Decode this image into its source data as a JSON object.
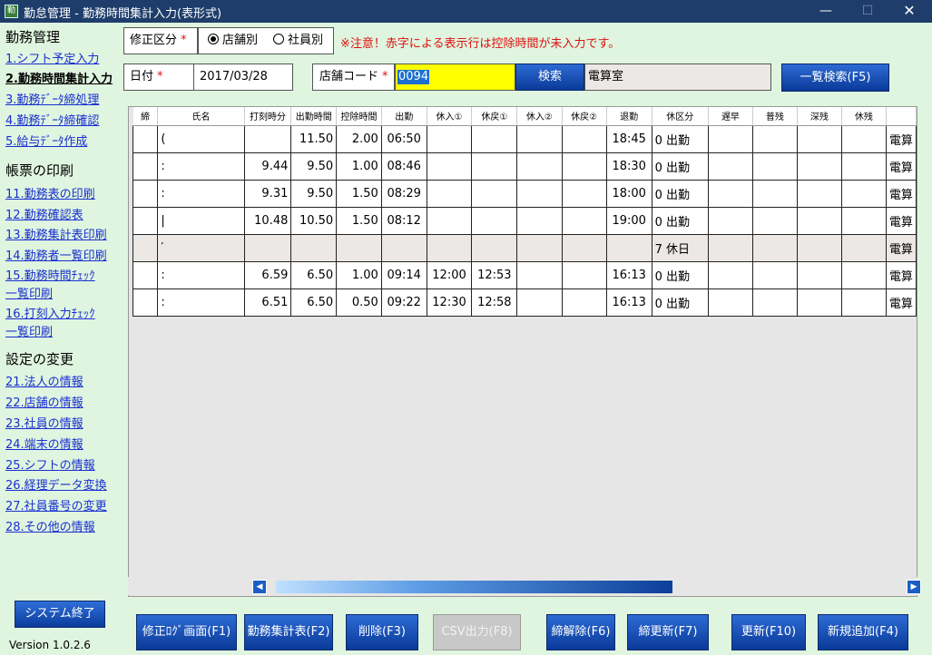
{
  "window": {
    "title": "勤怠管理 - 勤務時間集計入力(表形式)",
    "icon": "app-icon",
    "minimize": "—",
    "maximize": "☐",
    "close": "✕"
  },
  "sidebar": {
    "section1": "勤務管理",
    "links1": [
      "1.シフト予定入力",
      "2.勤務時間集計入力",
      "3.勤務ﾃﾞｰﾀ締処理",
      "4.勤務ﾃﾞｰﾀ締確認",
      "5.給与ﾃﾞｰﾀ作成"
    ],
    "section2": "帳票の印刷",
    "links2": [
      "11.勤務表の印刷",
      "12.勤務確認表",
      "13.勤務集計表印刷",
      "14.勤務者一覧印刷",
      "15.勤務時間ﾁｪｯｸ",
      "一覧印刷",
      "16.打刻入力ﾁｪｯｸ",
      "一覧印刷"
    ],
    "section3": "設定の変更",
    "links3": [
      "21.法人の情報",
      "22.店舗の情報",
      "23.社員の情報",
      "24.端末の情報",
      "25.シフトの情報",
      "26.経理データ変換",
      "27.社員番号の変更",
      "28.その他の情報"
    ],
    "exit_button": "システム終了",
    "version": "Version 1.0.2.6"
  },
  "form": {
    "mode_label": "修正区分",
    "required_mark": "*",
    "radio_store": "店舗別",
    "radio_staff": "社員別",
    "selected": "店舗別",
    "notice": "※注意！赤字による表示行は控除時間が未入力です。",
    "date_label": "日付",
    "date_value": "2017/03/28",
    "store_code_label": "店舗コード",
    "store_code_value": "0094",
    "search_button": "検索",
    "store_name": "電算室",
    "list_search_button": "一覧検索(F5)"
  },
  "grid": {
    "headers": [
      "締",
      "氏名",
      "打刻時分",
      "出勤時間",
      "控除時間",
      "出勤",
      "休入①",
      "休戻①",
      "休入②",
      "休戻②",
      "退勤",
      "休区分",
      "遅早",
      "普残",
      "深残",
      "休残",
      ""
    ],
    "rows": [
      {
        "name": "(",
        "punch": "",
        "work": "11.50",
        "deduct": "2.00",
        "in": "06:50",
        "b1in": "",
        "b1out": "",
        "b2in": "",
        "b2out": "",
        "out": "18:45",
        "kind": "0 出勤",
        "last": "電算",
        "holiday": false
      },
      {
        "name": ":",
        "punch": "9.44",
        "work": "9.50",
        "deduct": "1.00",
        "in": "08:46",
        "b1in": "",
        "b1out": "",
        "b2in": "",
        "b2out": "",
        "out": "18:30",
        "kind": "0 出勤",
        "last": "電算",
        "holiday": false
      },
      {
        "name": ":",
        "punch": "9.31",
        "work": "9.50",
        "deduct": "1.50",
        "in": "08:29",
        "b1in": "",
        "b1out": "",
        "b2in": "",
        "b2out": "",
        "out": "18:00",
        "kind": "0 出勤",
        "last": "電算",
        "holiday": false
      },
      {
        "name": "|",
        "punch": "10.48",
        "work": "10.50",
        "deduct": "1.50",
        "in": "08:12",
        "b1in": "",
        "b1out": "",
        "b2in": "",
        "b2out": "",
        "out": "19:00",
        "kind": "0 出勤",
        "last": "電算",
        "holiday": false
      },
      {
        "name": "′",
        "punch": "",
        "work": "",
        "deduct": "",
        "in": "",
        "b1in": "",
        "b1out": "",
        "b2in": "",
        "b2out": "",
        "out": "",
        "kind": "7 休日",
        "last": "電算",
        "holiday": true
      },
      {
        "name": ":",
        "punch": "6.59",
        "work": "6.50",
        "deduct": "1.00",
        "in": "09:14",
        "b1in": "12:00",
        "b1out": "12:53",
        "b2in": "",
        "b2out": "",
        "out": "16:13",
        "kind": "0 出勤",
        "last": "電算",
        "holiday": false
      },
      {
        "name": ":",
        "punch": "6.51",
        "work": "6.50",
        "deduct": "0.50",
        "in": "09:22",
        "b1in": "12:30",
        "b1out": "12:58",
        "b2in": "",
        "b2out": "",
        "out": "16:13",
        "kind": "0 出勤",
        "last": "電算",
        "holiday": false
      }
    ],
    "scroll_left": "◀",
    "scroll_right": "▶"
  },
  "buttons": {
    "f1": "修正ﾛｸﾞ画面(F1)",
    "f2": "勤務集計表(F2)",
    "f3": "削除(F3)",
    "f8": "CSV出力(F8)",
    "f6": "締解除(F6)",
    "f7": "締更新(F7)",
    "f10": "更新(F10)",
    "f4": "新規追加(F4)"
  },
  "colors": {
    "accent": "#0a3a99",
    "background": "#dff5df",
    "required": "#e01010",
    "highlight": "#ffff00"
  }
}
